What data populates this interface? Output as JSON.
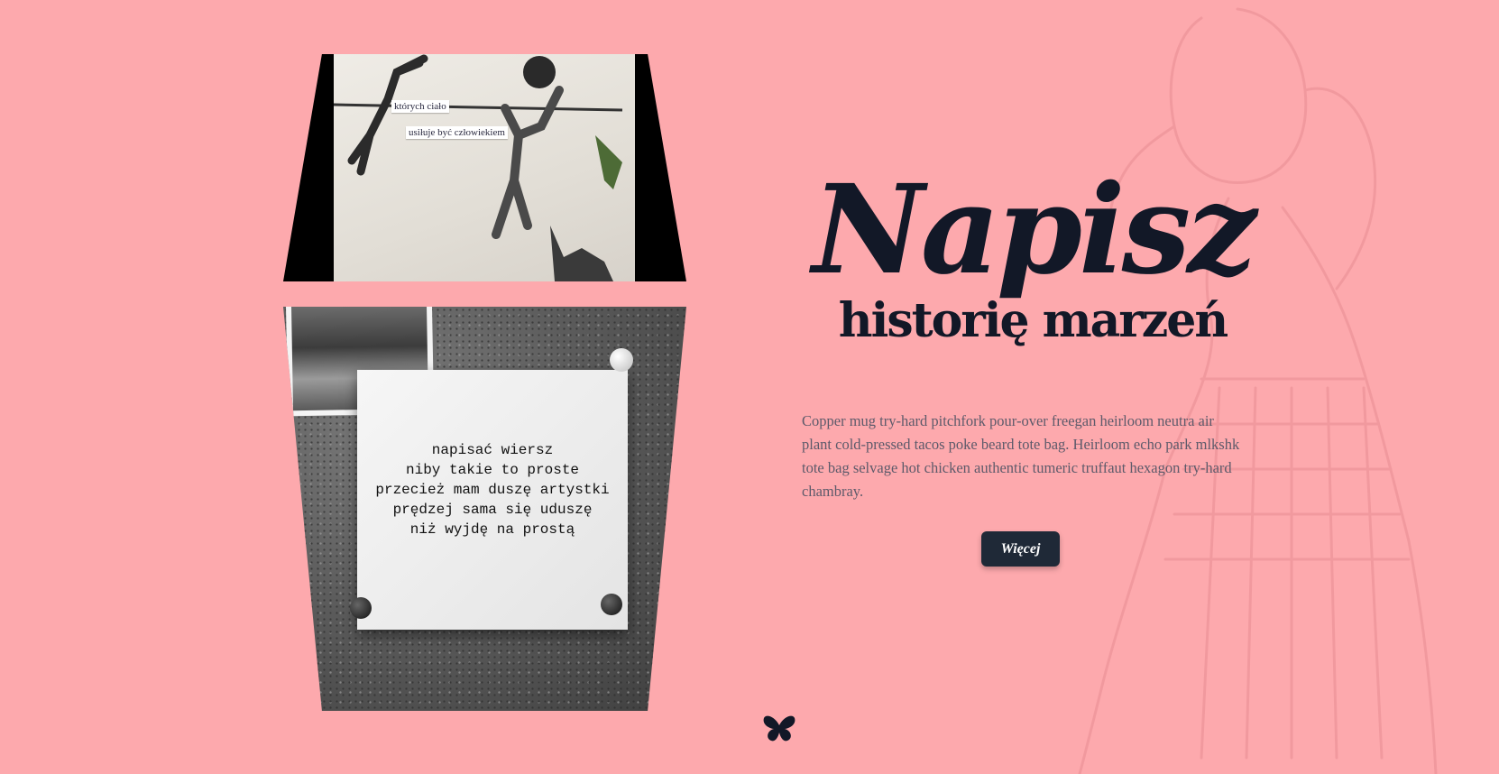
{
  "hero": {
    "title": "Napisz",
    "subtitle": "historię marzeń",
    "description": "Copper mug try-hard pitchfork pour-over freegan heirloom neutra air plant cold-pressed tacos poke beard tote bag. Heirloom echo park mlkshk tote bag selvage hot chicken authentic tumeric truffaut hexagon try-hard chambray.",
    "button_label": "Więcej"
  },
  "image_top": {
    "caption_1": "których ciało",
    "caption_2": "usiłuje być człowiekiem"
  },
  "image_bottom": {
    "poem_lines": [
      "napisać wiersz",
      "niby takie to proste",
      "przecież mam duszę artystki",
      "prędzej sama się uduszę",
      "niż wyjdę na prostą"
    ]
  },
  "icons": {
    "logo": "butterfly-icon",
    "background": "vintage-figure-illustration"
  },
  "colors": {
    "background": "#fda9ad",
    "text_dark": "#121827",
    "button": "#1f2937",
    "body_text": "#5d5a6a"
  }
}
